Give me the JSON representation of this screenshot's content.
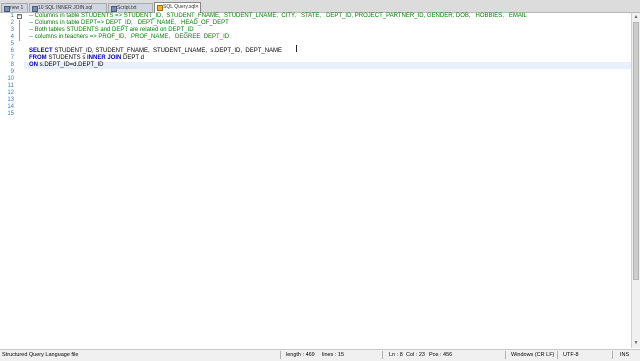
{
  "tabs": [
    {
      "label": "new 1"
    },
    {
      "label": "10 SQL INNER JOIN.sql"
    },
    {
      "label": "Script.txt"
    },
    {
      "label": "SQL Query.sql"
    }
  ],
  "lines": {
    "l1": "Columns in table STUDENTS => STUDENT_ID,  STUDENT_FNAME,  STUDENT_LNAME,  CITY,   STATE,   DEPT_ID, PROJECT_PARTNER_ID, GENDER, DOB,   HOBBIES,   EMAIL",
    "l2": "Columns in table DEPT=> DEPT_ID,   DEPT_NAME,   HEAD_OF_DEPT",
    "l3": "Both tables STUDENTS and DEPT are related on DEPT_ID",
    "l4": "columns in teachers => PROF_ID,   PROF_NAME,   DEGREE  DEPT_ID",
    "l6_kw": "SELECT",
    "l6_rest": " STUDENT_ID, STUDENT_FNAME,  STUDENT_LNAME,  s.DEPT_ID,  DEPT_NAME",
    "l7_kw1": "FROM",
    "l7_a": " STUDENTS s ",
    "l7_kw2": "INNER JOIN",
    "l7_b": " DEPT d",
    "l8_kw": "ON",
    "l8_rest": " s.DEPT_ID=d.DEPT_ID",
    "comment_prefix": "-- "
  },
  "line_numbers": [
    "1",
    "2",
    "3",
    "4",
    "5",
    "6",
    "7",
    "8",
    "9",
    "10",
    "11",
    "12",
    "13",
    "14",
    "15"
  ],
  "status": {
    "file_type": "Structured Query Language file",
    "length": "length : 469",
    "lines": "lines : 15",
    "ln": "Ln : 8",
    "col": "Col : 23",
    "pos": "Pos : 456",
    "eol": "Windows (CR LF)",
    "encoding": "UTF-8",
    "mode": "INS"
  },
  "colors": {
    "comment": "#008000",
    "keyword": "#0000c0",
    "line_number": "#3a7cc0"
  }
}
